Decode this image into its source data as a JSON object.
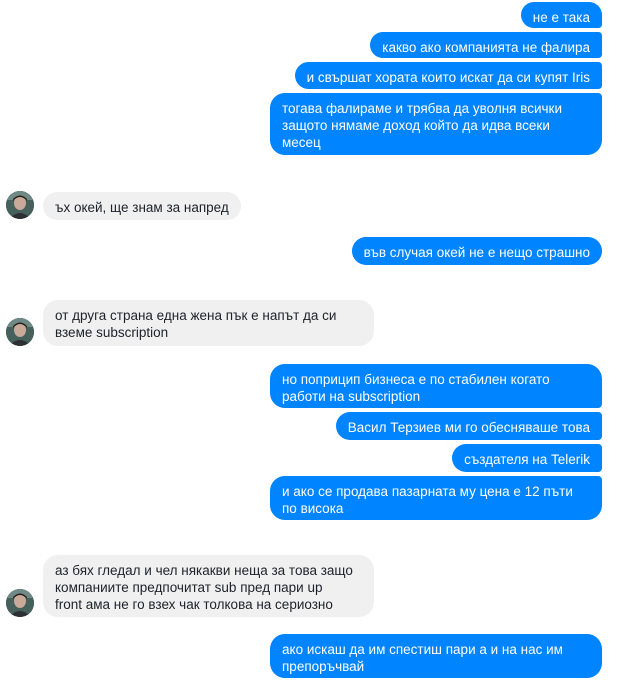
{
  "messages": [
    {
      "text": "не е така"
    },
    {
      "text": "какво ако компанията не фалира"
    },
    {
      "text": "и свършат хората които искат да си купят Iris"
    },
    {
      "text": "тогава фалираме и трябва да уволня всички\nзащото нямаме доход който да идва всеки\nмесец"
    },
    {
      "text": "ъх окей, ще знам за напред"
    },
    {
      "text": "във случая окей не е нещо страшно"
    },
    {
      "text": "от друга страна една жена пък е напът да си\nвземе subscription"
    },
    {
      "text": "но поприцип бизнеса е по стабилен когато\nработи на subscription"
    },
    {
      "text": "Васил Терзиев ми го обесняваше това"
    },
    {
      "text": "създателя на Telerik"
    },
    {
      "text": "и ако се продава пазарната му цена е 12 пъти\nпо висока"
    },
    {
      "text": "аз бях гледал и чел някакви неща за това защо\nкомпаниите предпочитат sub пред пари up\nfront ама не го взех чак толкова на сериозно"
    },
    {
      "text": "ако искаш да им спестиш пари а и на нас им\nпрепоръчвай"
    }
  ],
  "colors": {
    "outgoing": "#0084ff",
    "incoming": "#f1f0f0"
  }
}
